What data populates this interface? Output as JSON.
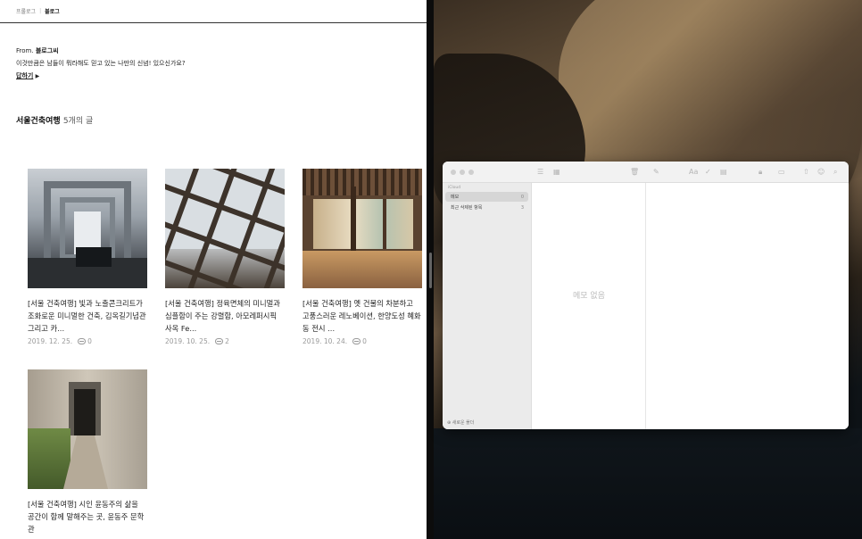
{
  "blog": {
    "tabs": [
      "프롤로그",
      "블로그"
    ],
    "from_label": "From.",
    "from_name": "블로그씨",
    "question": "이것만큼은 남들이 뭐라해도 믿고 있는 나만의 신념! 있으신가요?",
    "reply": "답하기",
    "category": "서울건축여행",
    "post_count": "5개의 글",
    "posts": [
      {
        "title": "[서울 건축여행] 빛과 노출콘크리트가 조화로운 미니멀한 건축, 김옥길기념관 그리고 카...",
        "date": "2019. 12. 25.",
        "comments": "0"
      },
      {
        "title": "[서울 건축여행] 정육면체의 미니멀과 심플함이 주는 강렬함, 아모레퍼시픽 사옥 Fe...",
        "date": "2019. 10. 25.",
        "comments": "2"
      },
      {
        "title": "[서울 건축여행] 옛 건물의 차분하고 고풍스러운 레노베이션, 한양도성 혜화동 전시 ...",
        "date": "2019. 10. 24.",
        "comments": "0"
      },
      {
        "title": "[서울 건축여행] 시인 윤동주의 삶을 공간이 함께 말해주는 곳, 윤동주 문학관",
        "date": "",
        "comments": ""
      }
    ]
  },
  "notes": {
    "account": "iCloud",
    "folders": [
      {
        "name": "메모",
        "count": "0"
      },
      {
        "name": "최근 삭제된 항목",
        "count": "3"
      }
    ],
    "new_folder": "새로운 폴더",
    "empty_text": "메모 없음",
    "toolbar_icons": [
      "list-view-icon",
      "gallery-view-icon",
      "trash-icon",
      "compose-icon",
      "format-icon",
      "checklist-icon",
      "table-icon",
      "lock-icon",
      "attachment-icon",
      "share-icon",
      "collaborate-icon",
      "search-icon"
    ]
  }
}
